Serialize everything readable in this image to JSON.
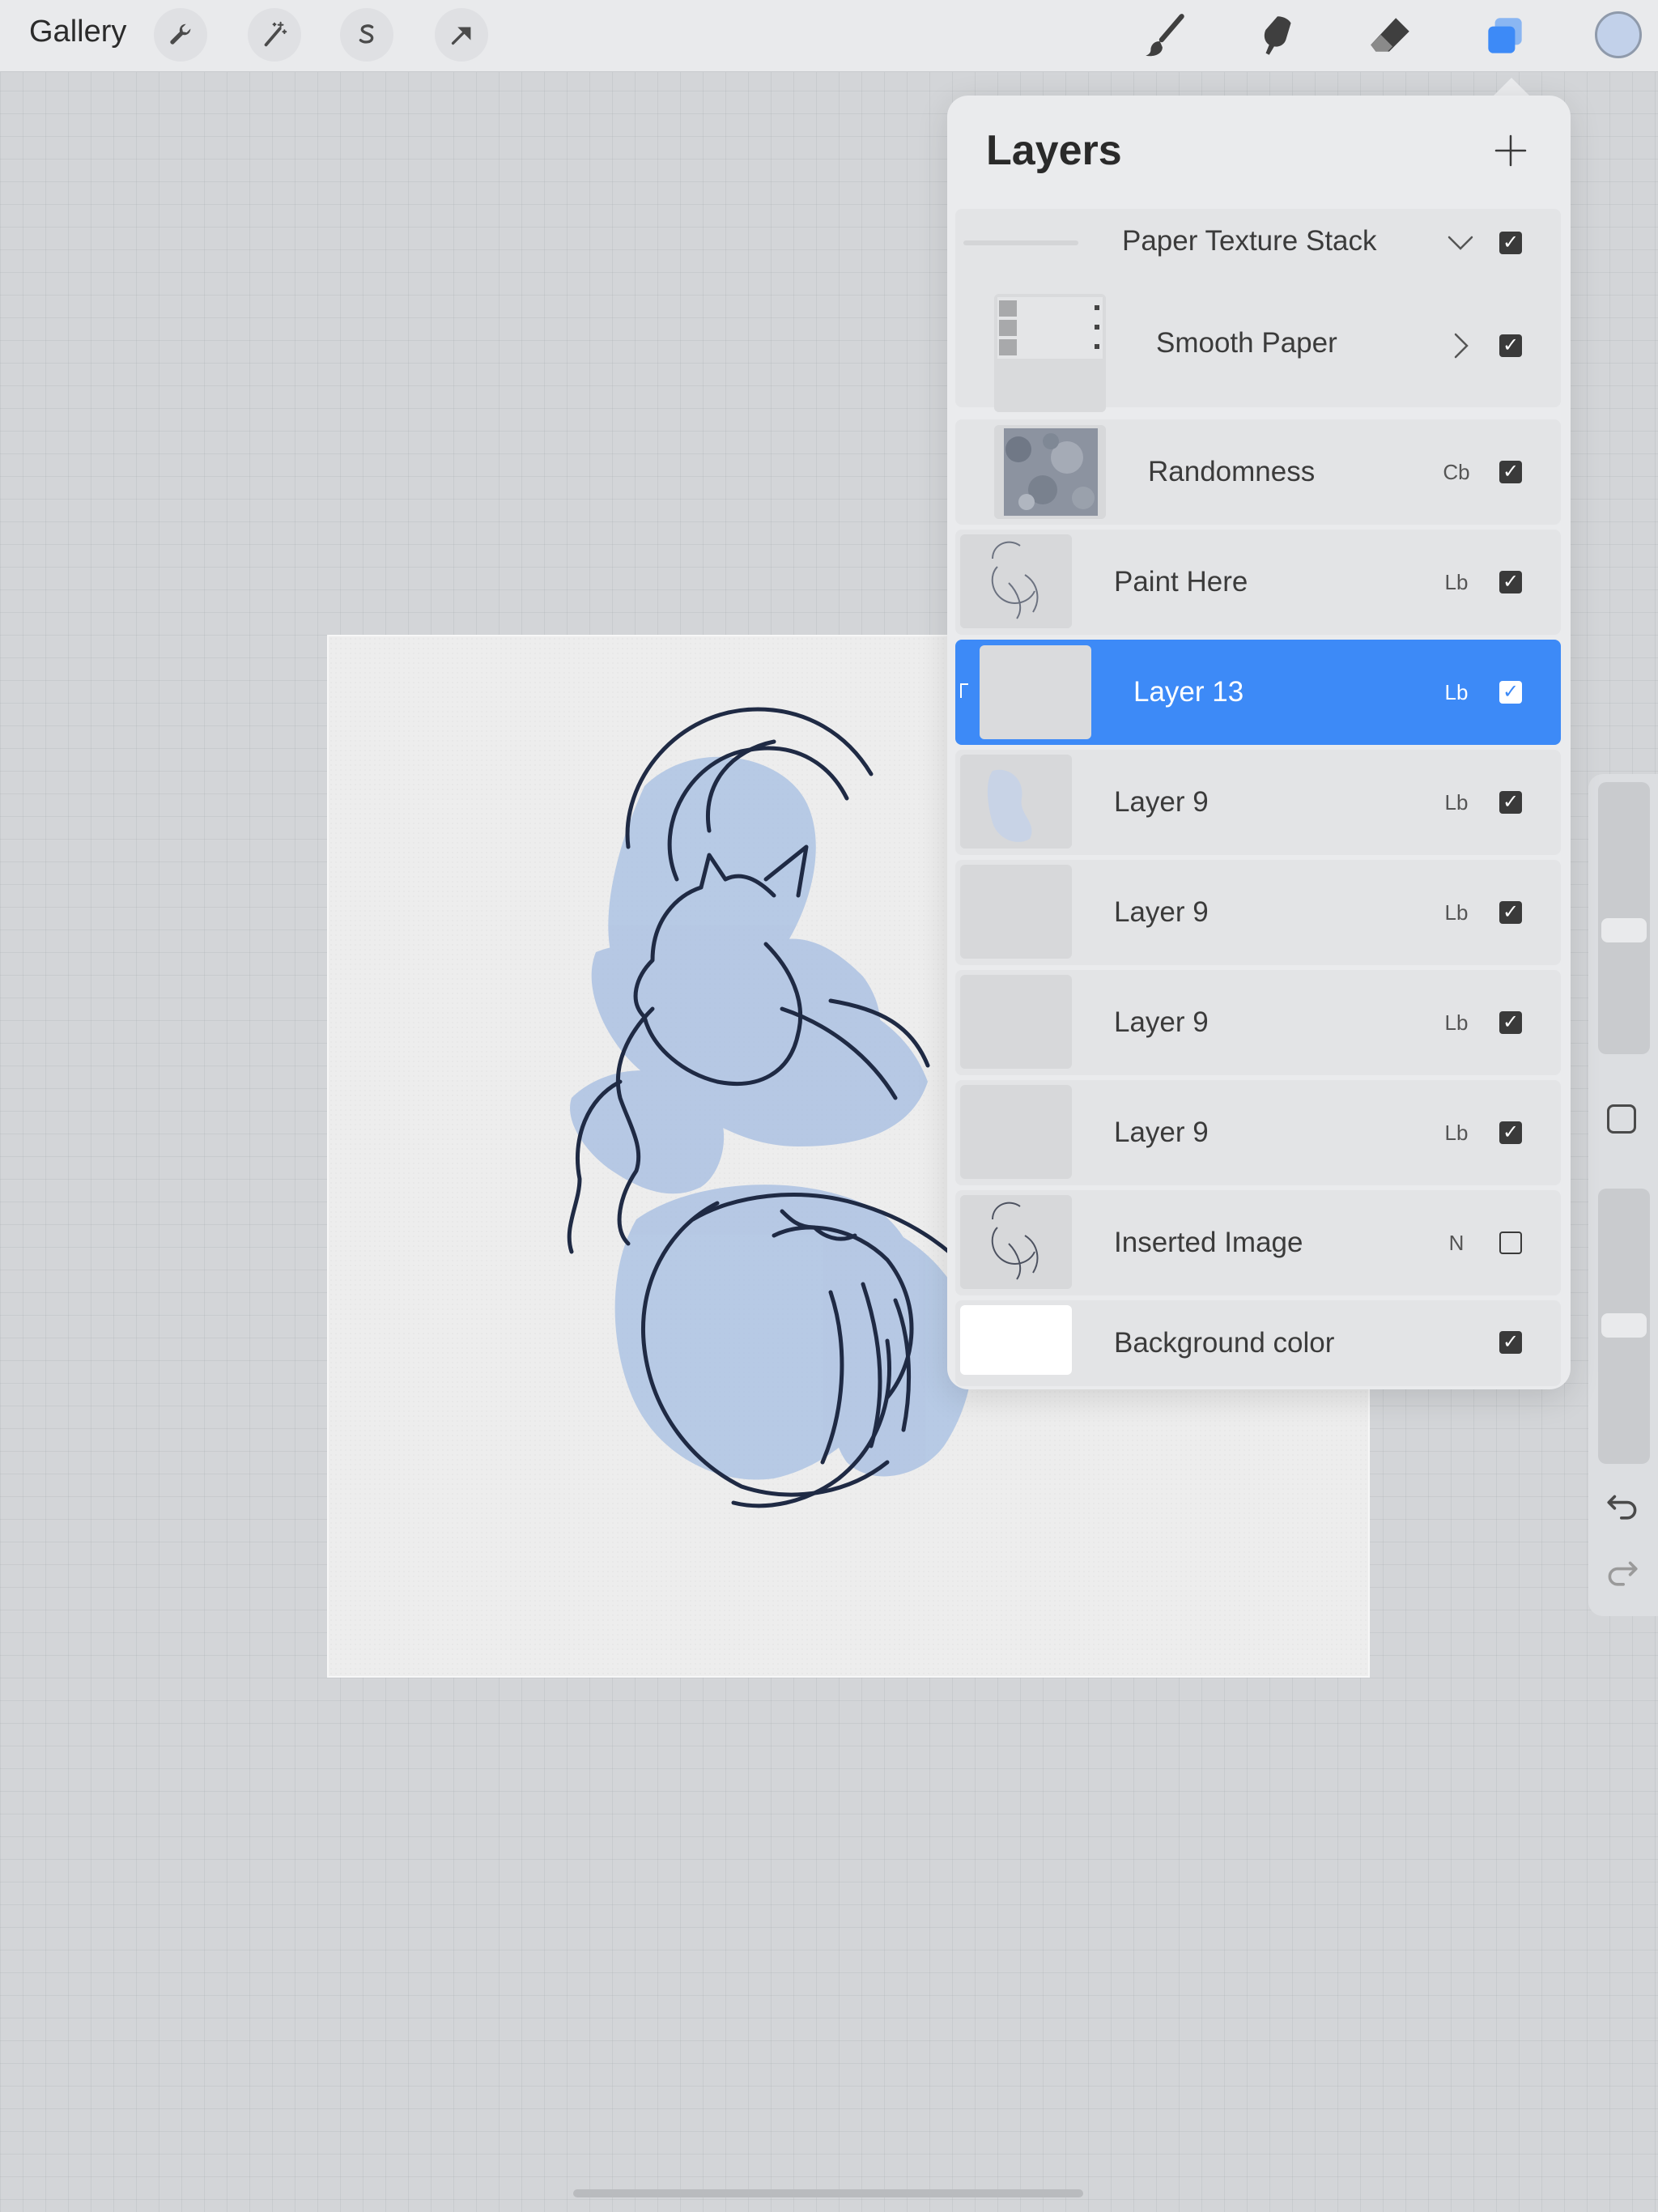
{
  "toolbar": {
    "gallery_label": "Gallery",
    "left_icons": [
      "wrench-icon",
      "magic-wand-icon",
      "selection-s-icon",
      "transform-arrow-icon"
    ],
    "right_icons": [
      "brush-icon",
      "smudge-icon",
      "eraser-icon",
      "layers-icon"
    ],
    "accent_color": "#3d8af7",
    "current_color": "#c2d1ea"
  },
  "layers_panel": {
    "title": "Layers",
    "layers": [
      {
        "name": "Paper Texture Stack",
        "blend": "",
        "visible": true,
        "kind": "group-expanded"
      },
      {
        "name": "Smooth Paper",
        "blend": "",
        "visible": true,
        "kind": "group-collapsed"
      },
      {
        "name": "Randomness",
        "blend": "Cb",
        "visible": true,
        "kind": "layer"
      },
      {
        "name": "Paint Here",
        "blend": "Lb",
        "visible": true,
        "kind": "layer"
      },
      {
        "name": "Layer 13",
        "blend": "Lb",
        "visible": true,
        "kind": "layer",
        "selected": true
      },
      {
        "name": "Layer 9",
        "blend": "Lb",
        "visible": true,
        "kind": "layer"
      },
      {
        "name": "Layer 9",
        "blend": "Lb",
        "visible": true,
        "kind": "layer"
      },
      {
        "name": "Layer 9",
        "blend": "Lb",
        "visible": true,
        "kind": "layer"
      },
      {
        "name": "Layer 9",
        "blend": "Lb",
        "visible": true,
        "kind": "layer"
      },
      {
        "name": "Inserted Image",
        "blend": "N",
        "visible": false,
        "kind": "layer"
      },
      {
        "name": "Background color",
        "blend": "",
        "visible": true,
        "kind": "background"
      }
    ]
  },
  "sidebar": {
    "icons": [
      "undo-icon",
      "redo-icon"
    ]
  }
}
